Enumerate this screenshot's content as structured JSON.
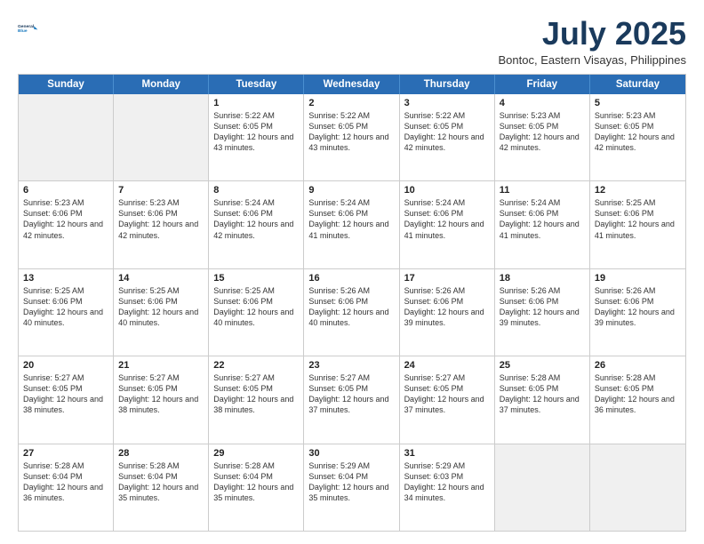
{
  "logo": {
    "line1": "General",
    "line2": "Blue"
  },
  "title": "July 2025",
  "location": "Bontoc, Eastern Visayas, Philippines",
  "header_days": [
    "Sunday",
    "Monday",
    "Tuesday",
    "Wednesday",
    "Thursday",
    "Friday",
    "Saturday"
  ],
  "weeks": [
    [
      {
        "day": "",
        "sunrise": "",
        "sunset": "",
        "daylight": "",
        "shaded": true
      },
      {
        "day": "",
        "sunrise": "",
        "sunset": "",
        "daylight": "",
        "shaded": true
      },
      {
        "day": "1",
        "sunrise": "Sunrise: 5:22 AM",
        "sunset": "Sunset: 6:05 PM",
        "daylight": "Daylight: 12 hours and 43 minutes."
      },
      {
        "day": "2",
        "sunrise": "Sunrise: 5:22 AM",
        "sunset": "Sunset: 6:05 PM",
        "daylight": "Daylight: 12 hours and 43 minutes."
      },
      {
        "day": "3",
        "sunrise": "Sunrise: 5:22 AM",
        "sunset": "Sunset: 6:05 PM",
        "daylight": "Daylight: 12 hours and 42 minutes."
      },
      {
        "day": "4",
        "sunrise": "Sunrise: 5:23 AM",
        "sunset": "Sunset: 6:05 PM",
        "daylight": "Daylight: 12 hours and 42 minutes."
      },
      {
        "day": "5",
        "sunrise": "Sunrise: 5:23 AM",
        "sunset": "Sunset: 6:05 PM",
        "daylight": "Daylight: 12 hours and 42 minutes."
      }
    ],
    [
      {
        "day": "6",
        "sunrise": "Sunrise: 5:23 AM",
        "sunset": "Sunset: 6:06 PM",
        "daylight": "Daylight: 12 hours and 42 minutes."
      },
      {
        "day": "7",
        "sunrise": "Sunrise: 5:23 AM",
        "sunset": "Sunset: 6:06 PM",
        "daylight": "Daylight: 12 hours and 42 minutes."
      },
      {
        "day": "8",
        "sunrise": "Sunrise: 5:24 AM",
        "sunset": "Sunset: 6:06 PM",
        "daylight": "Daylight: 12 hours and 42 minutes."
      },
      {
        "day": "9",
        "sunrise": "Sunrise: 5:24 AM",
        "sunset": "Sunset: 6:06 PM",
        "daylight": "Daylight: 12 hours and 41 minutes."
      },
      {
        "day": "10",
        "sunrise": "Sunrise: 5:24 AM",
        "sunset": "Sunset: 6:06 PM",
        "daylight": "Daylight: 12 hours and 41 minutes."
      },
      {
        "day": "11",
        "sunrise": "Sunrise: 5:24 AM",
        "sunset": "Sunset: 6:06 PM",
        "daylight": "Daylight: 12 hours and 41 minutes."
      },
      {
        "day": "12",
        "sunrise": "Sunrise: 5:25 AM",
        "sunset": "Sunset: 6:06 PM",
        "daylight": "Daylight: 12 hours and 41 minutes."
      }
    ],
    [
      {
        "day": "13",
        "sunrise": "Sunrise: 5:25 AM",
        "sunset": "Sunset: 6:06 PM",
        "daylight": "Daylight: 12 hours and 40 minutes."
      },
      {
        "day": "14",
        "sunrise": "Sunrise: 5:25 AM",
        "sunset": "Sunset: 6:06 PM",
        "daylight": "Daylight: 12 hours and 40 minutes."
      },
      {
        "day": "15",
        "sunrise": "Sunrise: 5:25 AM",
        "sunset": "Sunset: 6:06 PM",
        "daylight": "Daylight: 12 hours and 40 minutes."
      },
      {
        "day": "16",
        "sunrise": "Sunrise: 5:26 AM",
        "sunset": "Sunset: 6:06 PM",
        "daylight": "Daylight: 12 hours and 40 minutes."
      },
      {
        "day": "17",
        "sunrise": "Sunrise: 5:26 AM",
        "sunset": "Sunset: 6:06 PM",
        "daylight": "Daylight: 12 hours and 39 minutes."
      },
      {
        "day": "18",
        "sunrise": "Sunrise: 5:26 AM",
        "sunset": "Sunset: 6:06 PM",
        "daylight": "Daylight: 12 hours and 39 minutes."
      },
      {
        "day": "19",
        "sunrise": "Sunrise: 5:26 AM",
        "sunset": "Sunset: 6:06 PM",
        "daylight": "Daylight: 12 hours and 39 minutes."
      }
    ],
    [
      {
        "day": "20",
        "sunrise": "Sunrise: 5:27 AM",
        "sunset": "Sunset: 6:05 PM",
        "daylight": "Daylight: 12 hours and 38 minutes."
      },
      {
        "day": "21",
        "sunrise": "Sunrise: 5:27 AM",
        "sunset": "Sunset: 6:05 PM",
        "daylight": "Daylight: 12 hours and 38 minutes."
      },
      {
        "day": "22",
        "sunrise": "Sunrise: 5:27 AM",
        "sunset": "Sunset: 6:05 PM",
        "daylight": "Daylight: 12 hours and 38 minutes."
      },
      {
        "day": "23",
        "sunrise": "Sunrise: 5:27 AM",
        "sunset": "Sunset: 6:05 PM",
        "daylight": "Daylight: 12 hours and 37 minutes."
      },
      {
        "day": "24",
        "sunrise": "Sunrise: 5:27 AM",
        "sunset": "Sunset: 6:05 PM",
        "daylight": "Daylight: 12 hours and 37 minutes."
      },
      {
        "day": "25",
        "sunrise": "Sunrise: 5:28 AM",
        "sunset": "Sunset: 6:05 PM",
        "daylight": "Daylight: 12 hours and 37 minutes."
      },
      {
        "day": "26",
        "sunrise": "Sunrise: 5:28 AM",
        "sunset": "Sunset: 6:05 PM",
        "daylight": "Daylight: 12 hours and 36 minutes."
      }
    ],
    [
      {
        "day": "27",
        "sunrise": "Sunrise: 5:28 AM",
        "sunset": "Sunset: 6:04 PM",
        "daylight": "Daylight: 12 hours and 36 minutes."
      },
      {
        "day": "28",
        "sunrise": "Sunrise: 5:28 AM",
        "sunset": "Sunset: 6:04 PM",
        "daylight": "Daylight: 12 hours and 35 minutes."
      },
      {
        "day": "29",
        "sunrise": "Sunrise: 5:28 AM",
        "sunset": "Sunset: 6:04 PM",
        "daylight": "Daylight: 12 hours and 35 minutes."
      },
      {
        "day": "30",
        "sunrise": "Sunrise: 5:29 AM",
        "sunset": "Sunset: 6:04 PM",
        "daylight": "Daylight: 12 hours and 35 minutes."
      },
      {
        "day": "31",
        "sunrise": "Sunrise: 5:29 AM",
        "sunset": "Sunset: 6:03 PM",
        "daylight": "Daylight: 12 hours and 34 minutes."
      },
      {
        "day": "",
        "sunrise": "",
        "sunset": "",
        "daylight": "",
        "shaded": true
      },
      {
        "day": "",
        "sunrise": "",
        "sunset": "",
        "daylight": "",
        "shaded": true
      }
    ]
  ]
}
